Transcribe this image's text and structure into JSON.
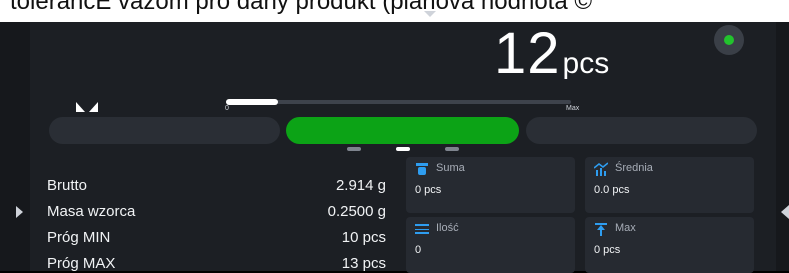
{
  "overlay_caption": "tolerancE vażom pro dany produkt (planova hodnota ©",
  "reading": {
    "value": "12",
    "unit": "pcs",
    "progress_fraction": 0.15
  },
  "bar": {
    "min_label": "0",
    "max_label": "Max"
  },
  "zone_colors": {
    "low": "#2a2e35",
    "ok": "#0ca316",
    "high": "#2a2e35"
  },
  "status_color": "#22c32d",
  "pager": {
    "count": 3,
    "active_index": 1
  },
  "info_rows": [
    {
      "label": "Brutto",
      "value": "2.914  g"
    },
    {
      "label": "Masa wzorca",
      "value": "0.2500 g"
    },
    {
      "label": "Próg MIN",
      "value": "10 pcs"
    },
    {
      "label": "Próg MAX",
      "value": "13 pcs"
    }
  ],
  "tiles": [
    {
      "title": "Suma",
      "value": "0 pcs",
      "icon": "sum-icon"
    },
    {
      "title": "Średnia",
      "value": "0.0 pcs",
      "icon": "average-icon"
    },
    {
      "title": "Ilość",
      "value": "0",
      "icon": "count-icon"
    },
    {
      "title": "Max",
      "value": "0 pcs",
      "icon": "max-icon"
    }
  ]
}
